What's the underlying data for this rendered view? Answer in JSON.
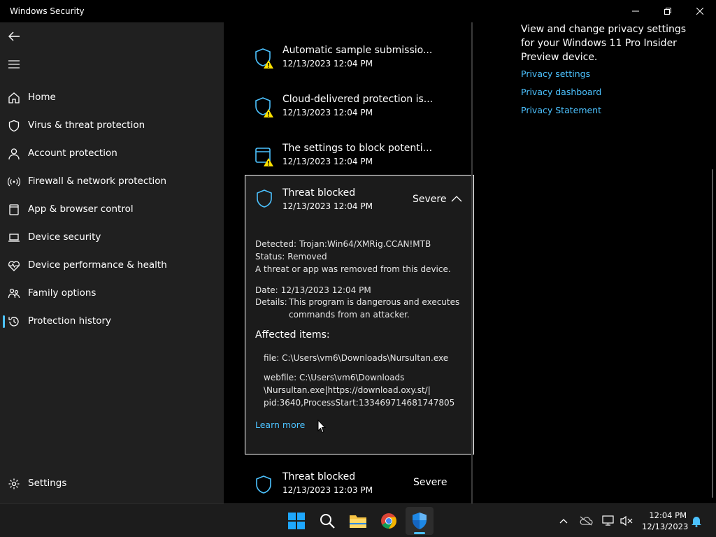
{
  "window": {
    "title": "Windows Security"
  },
  "sidebar": {
    "items": [
      {
        "label": "Home",
        "icon": "home-icon"
      },
      {
        "label": "Virus & threat protection",
        "icon": "shield-icon"
      },
      {
        "label": "Account protection",
        "icon": "person-icon"
      },
      {
        "label": "Firewall & network protection",
        "icon": "wifi-icon"
      },
      {
        "label": "App & browser control",
        "icon": "window-icon"
      },
      {
        "label": "Device security",
        "icon": "laptop-icon"
      },
      {
        "label": "Device performance & health",
        "icon": "heart-icon"
      },
      {
        "label": "Family options",
        "icon": "family-icon"
      },
      {
        "label": "Protection history",
        "icon": "history-icon",
        "active": true
      }
    ],
    "settings_label": "Settings"
  },
  "history": {
    "items": [
      {
        "title": "Automatic sample submissio...",
        "date": "12/13/2023 12:04 PM"
      },
      {
        "title": "Cloud-delivered protection is...",
        "date": "12/13/2023 12:04 PM"
      },
      {
        "title": "The settings to block potenti...",
        "date": "12/13/2023 12:04 PM"
      }
    ],
    "expanded": {
      "title": "Threat blocked",
      "date": "12/13/2023 12:04 PM",
      "severity": "Severe",
      "detected_label": "Detected:",
      "detected_value": "Trojan:Win64/XMRig.CCAN!MTB",
      "status_label": "Status:",
      "status_value": "Removed",
      "status_note": "A threat or app was removed from this device.",
      "date_label": "Date:",
      "date_value": "12/13/2023 12:04 PM",
      "details_label": "Details:",
      "details_line1": "This program is dangerous and executes",
      "details_line2": "commands from an attacker.",
      "affected_title": "Affected items:",
      "affected_file": "file: C:\\Users\\vm6\\Downloads\\Nursultan.exe",
      "affected_web_line1": "webfile: C:\\Users\\vm6\\Downloads",
      "affected_web_line2": "\\Nursultan.exe|https://download.oxy.st/|",
      "affected_web_line3": "pid:3640,ProcessStart:133469714681747805",
      "learn_more": "Learn more"
    },
    "last": {
      "title": "Threat blocked",
      "date": "12/13/2023 12:03 PM",
      "severity": "Severe"
    }
  },
  "privacy": {
    "text": "View and change privacy settings for your Windows 11 Pro Insider Preview device.",
    "links": [
      "Privacy settings",
      "Privacy dashboard",
      "Privacy Statement"
    ]
  },
  "taskbar": {
    "apps": [
      "start-icon",
      "search-icon",
      "file-explorer-icon",
      "chrome-icon",
      "windows-security-icon"
    ],
    "time": "12:04 PM",
    "date": "12/13/2023"
  },
  "colors": {
    "accent": "#4cc2ff",
    "warning": "#fce100",
    "sidebar": "#202020"
  }
}
